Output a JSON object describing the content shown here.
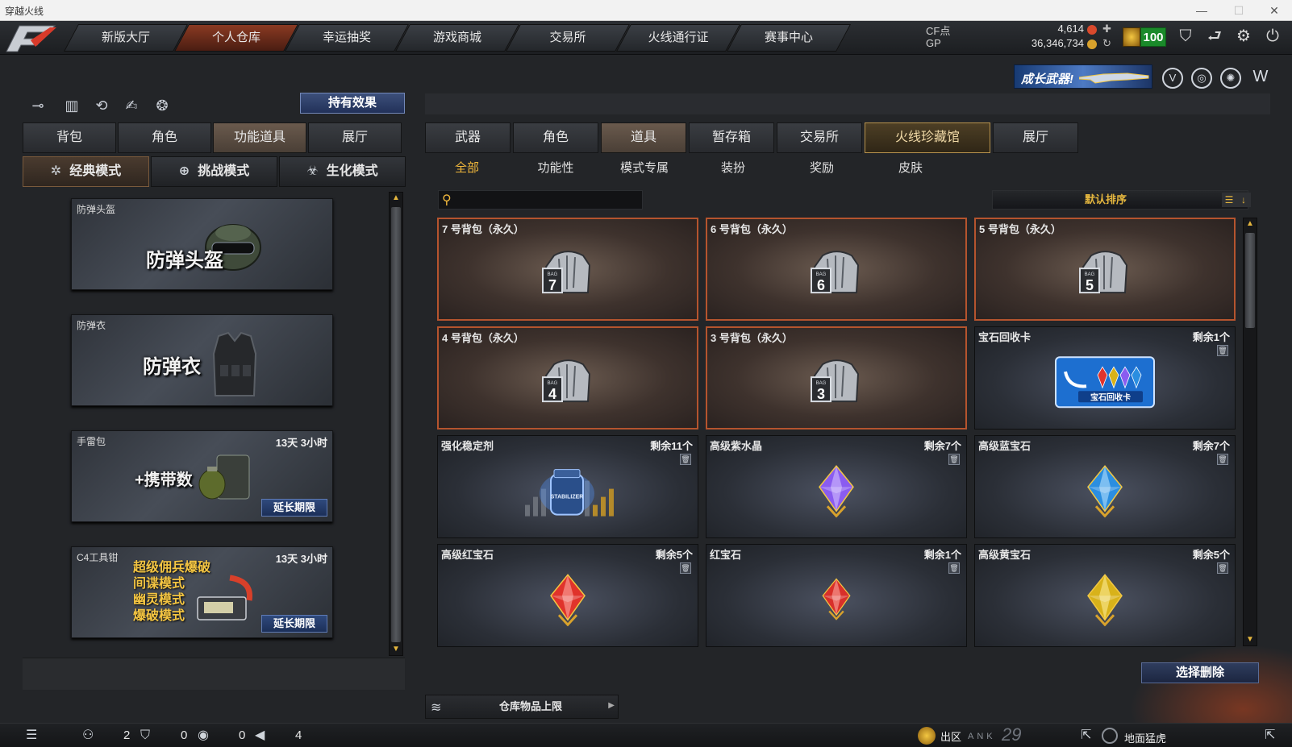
{
  "window": {
    "title": "穿越火线",
    "minimize": "—",
    "maximize": "☐",
    "close": "✕"
  },
  "nav": {
    "tabs": [
      {
        "label": "新版大厅"
      },
      {
        "label": "个人仓库",
        "active": true
      },
      {
        "label": "幸运抽奖"
      },
      {
        "label": "游戏商城"
      },
      {
        "label": "交易所"
      },
      {
        "label": "火线通行证"
      },
      {
        "label": "赛事中心"
      }
    ]
  },
  "currency": {
    "cf_label": "CF点",
    "cf_value": "4,614",
    "gp_label": "GP",
    "gp_value": "36,346,734",
    "level": "100"
  },
  "banner": {
    "text": "成长武器!"
  },
  "left": {
    "hold_effect_label": "持有效果",
    "tabs": [
      {
        "label": "背包"
      },
      {
        "label": "角色"
      },
      {
        "label": "功能道具",
        "active": true
      },
      {
        "label": "展厅"
      }
    ],
    "modes": [
      {
        "label": "经典模式",
        "active": true,
        "icon": "✲"
      },
      {
        "label": "挑战模式",
        "icon": "⊕"
      },
      {
        "label": "生化模式",
        "icon": "☣"
      }
    ],
    "cards": [
      {
        "name": "防弹头盔",
        "big": "防弹头盔",
        "time": "",
        "extend": ""
      },
      {
        "name": "防弹衣",
        "big": "防弹衣",
        "time": "",
        "extend": ""
      },
      {
        "name": "手雷包",
        "big": "+携带数",
        "time": "13天 3小时",
        "extend": "延长期限"
      },
      {
        "name": "C4工具钳",
        "lines": [
          "超级佣兵爆破",
          "间谍模式",
          "幽灵模式",
          "爆破模式"
        ],
        "time": "13天 3小时",
        "extend": "延长期限"
      }
    ]
  },
  "right": {
    "tabs": [
      {
        "label": "武器"
      },
      {
        "label": "角色"
      },
      {
        "label": "道具",
        "active": true
      },
      {
        "label": "暂存箱"
      },
      {
        "label": "交易所"
      },
      {
        "label": "火线珍藏馆",
        "special": true
      },
      {
        "label": "展厅"
      }
    ],
    "subtabs": [
      {
        "label": "全部",
        "active": true
      },
      {
        "label": "功能性"
      },
      {
        "label": "模式专属"
      },
      {
        "label": "装扮"
      },
      {
        "label": "奖励"
      },
      {
        "label": "皮肤"
      }
    ],
    "search_placeholder": "",
    "sort_label": "默认排序",
    "items": [
      {
        "name": "7 号背包（永久）",
        "count": "",
        "bag": "7",
        "type": "bag"
      },
      {
        "name": "6 号背包（永久）",
        "count": "",
        "bag": "6",
        "type": "bag"
      },
      {
        "name": "5 号背包（永久）",
        "count": "",
        "bag": "5",
        "type": "bag"
      },
      {
        "name": "4 号背包（永久）",
        "count": "",
        "bag": "4",
        "type": "bag"
      },
      {
        "name": "3 号背包（永久）",
        "count": "",
        "bag": "3",
        "type": "bag"
      },
      {
        "name": "宝石回收卡",
        "count": "剩余1个",
        "type": "card",
        "card_text": "宝石回收卡"
      },
      {
        "name": "强化稳定剂",
        "count": "剩余11个",
        "type": "jar",
        "jar_text": "STABILIZER"
      },
      {
        "name": "高级紫水晶",
        "count": "剩余7个",
        "type": "gem",
        "color": "#8a5cf0",
        "hi": "#d8c6ff"
      },
      {
        "name": "高级蓝宝石",
        "count": "剩余7个",
        "type": "gem",
        "color": "#2b8ee0",
        "hi": "#bfe6ff"
      },
      {
        "name": "高级红宝石",
        "count": "剩余5个",
        "type": "gem",
        "color": "#e0332b",
        "hi": "#ffb3ab"
      },
      {
        "name": "红宝石",
        "count": "剩余1个",
        "type": "gem",
        "color": "#d8302a",
        "hi": "#ffb0a8",
        "small": true
      },
      {
        "name": "高级黄宝石",
        "count": "剩余5个",
        "type": "gem",
        "color": "#d8b21a",
        "hi": "#fff1a0"
      }
    ],
    "select_delete_label": "选择删除",
    "capacity_label": "仓库物品上限"
  },
  "status": {
    "n1": "2",
    "n2": "0",
    "n3": "0",
    "n4": "4",
    "region": "出区",
    "rank_text": "ANK",
    "rank_num": "29",
    "player": "地面猛虎"
  }
}
